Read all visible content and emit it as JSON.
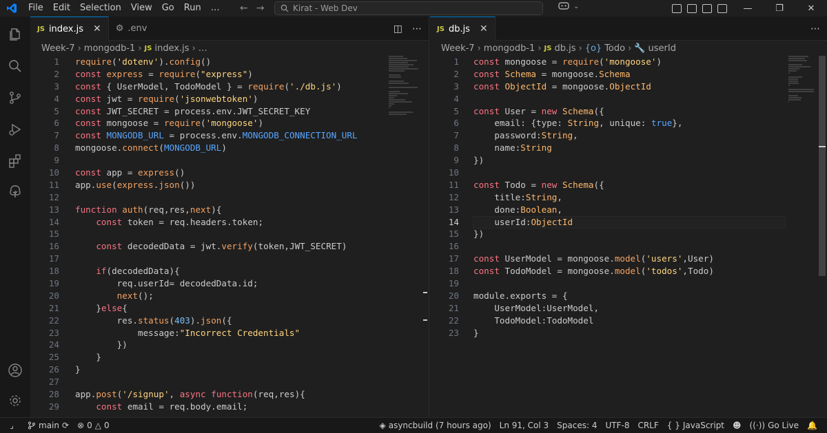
{
  "menu": [
    "File",
    "Edit",
    "Selection",
    "View",
    "Go",
    "Run",
    "…"
  ],
  "search": {
    "text": "Kirat - Web Dev"
  },
  "left_editor": {
    "tabs": [
      {
        "label": "index.js",
        "icon": "JS",
        "active": true
      },
      {
        "label": ".env",
        "icon": "gear",
        "active": false
      }
    ],
    "breadcrumb": [
      "Week-7",
      "mongodb-1",
      "index.js",
      "…"
    ],
    "lines": [
      {
        "n": "1",
        "code": "require('dotenv').config()"
      },
      {
        "n": "2",
        "code": "const express = require(\"express\")"
      },
      {
        "n": "3",
        "code": "const { UserModel, TodoModel } = require('./db.js')"
      },
      {
        "n": "4",
        "code": "const jwt = require('jsonwebtoken')"
      },
      {
        "n": "5",
        "code": "const JWT_SECRET = process.env.JWT_SECRET_KEY"
      },
      {
        "n": "6",
        "code": "const mongoose = require('mongoose')"
      },
      {
        "n": "7",
        "code": "const MONGODB_URL = process.env.MONGODB_CONNECTION_URL"
      },
      {
        "n": "8",
        "code": "mongoose.connect(MONGODB_URL)"
      },
      {
        "n": "9",
        "code": ""
      },
      {
        "n": "10",
        "code": "const app = express()"
      },
      {
        "n": "11",
        "code": "app.use(express.json())"
      },
      {
        "n": "12",
        "code": ""
      },
      {
        "n": "13",
        "code": "function auth(req,res,next){"
      },
      {
        "n": "14",
        "code": "    const token = req.headers.token;"
      },
      {
        "n": "15",
        "code": ""
      },
      {
        "n": "16",
        "code": "    const decodedData = jwt.verify(token,JWT_SECRET)"
      },
      {
        "n": "17",
        "code": ""
      },
      {
        "n": "18",
        "code": "    if(decodedData){"
      },
      {
        "n": "19",
        "code": "        req.userId= decodedData.id;"
      },
      {
        "n": "20",
        "code": "        next();"
      },
      {
        "n": "21",
        "code": "    }else{"
      },
      {
        "n": "22",
        "code": "        res.status(403).json({"
      },
      {
        "n": "23",
        "code": "            message:\"Incorrect Credentials\""
      },
      {
        "n": "24",
        "code": "        })"
      },
      {
        "n": "25",
        "code": "    }"
      },
      {
        "n": "26",
        "code": "}"
      },
      {
        "n": "27",
        "code": ""
      },
      {
        "n": "28",
        "code": "app.post('/signup', async function(req,res){"
      },
      {
        "n": "29",
        "code": "    const email = req.body.email;"
      }
    ]
  },
  "right_editor": {
    "tabs": [
      {
        "label": "db.js",
        "icon": "JS",
        "active": true
      }
    ],
    "breadcrumb": [
      "Week-7",
      "mongodb-1",
      "db.js",
      "Todo",
      "userId"
    ],
    "current_line": "14",
    "lines": [
      {
        "n": "1",
        "code": "const mongoose = require('mongoose')"
      },
      {
        "n": "2",
        "code": "const Schema = mongoose.Schema"
      },
      {
        "n": "3",
        "code": "const ObjectId = mongoose.ObjectId"
      },
      {
        "n": "4",
        "code": ""
      },
      {
        "n": "5",
        "code": "const User = new Schema({"
      },
      {
        "n": "6",
        "code": "    email: {type: String, unique: true},"
      },
      {
        "n": "7",
        "code": "    password:String,"
      },
      {
        "n": "8",
        "code": "    name:String"
      },
      {
        "n": "9",
        "code": "})"
      },
      {
        "n": "10",
        "code": ""
      },
      {
        "n": "11",
        "code": "const Todo = new Schema({"
      },
      {
        "n": "12",
        "code": "    title:String,"
      },
      {
        "n": "13",
        "code": "    done:Boolean,"
      },
      {
        "n": "14",
        "code": "    userId:ObjectId"
      },
      {
        "n": "15",
        "code": "})"
      },
      {
        "n": "16",
        "code": ""
      },
      {
        "n": "17",
        "code": "const UserModel = mongoose.model('users',User)"
      },
      {
        "n": "18",
        "code": "const TodoModel = mongoose.model('todos',Todo)"
      },
      {
        "n": "19",
        "code": ""
      },
      {
        "n": "20",
        "code": "module.exports = {"
      },
      {
        "n": "21",
        "code": "    UserModel:UserModel,"
      },
      {
        "n": "22",
        "code": "    TodoModel:TodoModel"
      },
      {
        "n": "23",
        "code": "}"
      }
    ]
  },
  "status": {
    "branch": "main",
    "errors": "0",
    "warnings": "0",
    "commit": "asyncbuild (7 hours ago)",
    "position": "Ln 91, Col 3",
    "spaces": "Spaces: 4",
    "encoding": "UTF-8",
    "eol": "CRLF",
    "language": "JavaScript",
    "golive": "Go Live"
  },
  "colors": {
    "accent": "#0078d4",
    "keyword": "#f97583",
    "function": "#f4a261",
    "string": "#ffd580"
  }
}
